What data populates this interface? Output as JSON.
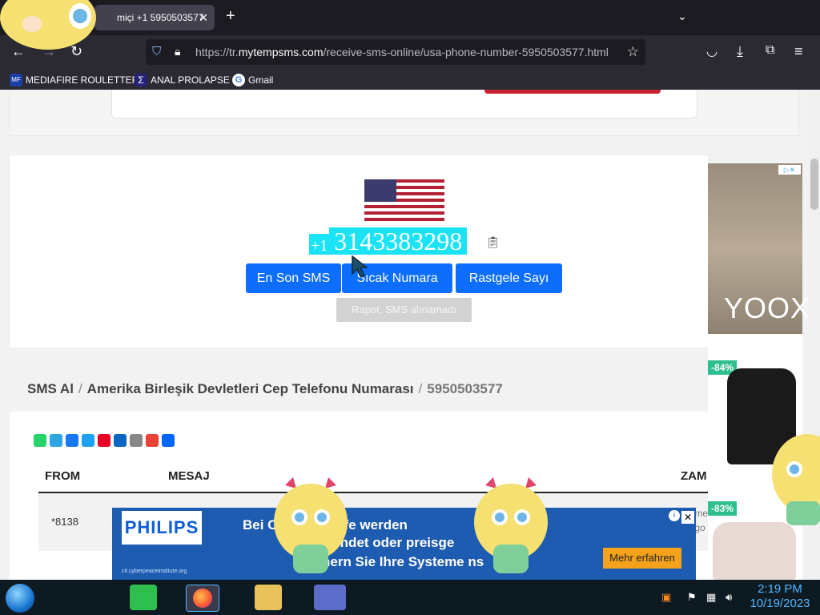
{
  "browser": {
    "tab_title": "miçi +1 5950503577",
    "url_prefix": "https://tr.",
    "url_domain": "mytempsms.com",
    "url_path": "/receive-sms-online/usa-phone-number-5950503577.html",
    "bookmarks": [
      {
        "label": "MEDIAFIRE ROULETTER",
        "icon": "mediafire-icon"
      },
      {
        "label": "ANAL PROLAPSE",
        "icon": "sigma-icon"
      },
      {
        "label": "Gmail",
        "icon": "google-icon"
      }
    ]
  },
  "phone": {
    "country_code": "+1",
    "number": "3143383298"
  },
  "buttons": {
    "latest_sms": "En Son SMS",
    "hot_number": "Sıcak Numara",
    "random_number": "Rastgele Sayı",
    "report": "Rapor, SMS alınamadı"
  },
  "breadcrumb": {
    "home": "SMS Al",
    "category": "Amerika Birleşik Devletleri Cep Telefonu Numarası",
    "current": "5950503577"
  },
  "table": {
    "headers": {
      "from": "FROM",
      "message": "MESAJ",
      "time": "ZAM"
    },
    "rows": [
      {
        "from": "*8138",
        "time_a": "me",
        "time_b": "go"
      }
    ]
  },
  "ad_right": {
    "brand": "YOOX",
    "discount1": "-84%",
    "discount2": "-83%"
  },
  "ad_bottom": {
    "brand": "PHILIPS",
    "line1": "Bei        Cyberangriffe werden",
    "line2": "wendet oder preisge",
    "line3": "hern Sie Ihre Systeme   ns",
    "cta": "Mehr erfahren",
    "source": "cit.cyberpeaceinstitute.org"
  },
  "taskbar": {
    "time": "2:19 PM",
    "date": "10/19/2023"
  },
  "colors": {
    "primary_button": "#0d6efd",
    "phone_highlight": "#19e3f5",
    "discount": "#2ebf91"
  }
}
